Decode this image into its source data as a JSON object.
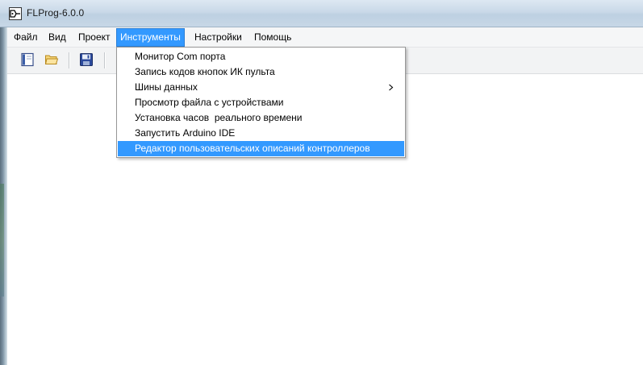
{
  "window": {
    "title": "FLProg-6.0.0"
  },
  "menubar": {
    "items": [
      {
        "label": "Файл"
      },
      {
        "label": "Вид"
      },
      {
        "label": "Проект"
      },
      {
        "label": "Инструменты"
      },
      {
        "label": "Настройки"
      },
      {
        "label": "Помощь"
      }
    ],
    "active_index": 3
  },
  "toolbar": {
    "buttons": [
      "new-project-icon",
      "open-folder-icon",
      "save-icon"
    ]
  },
  "dropdown": {
    "items": [
      {
        "label": "Монитор Com порта"
      },
      {
        "label": "Запись кодов кнопок ИК пульта"
      },
      {
        "label": "Шины данных",
        "submenu_icon": "chevron-right-icon"
      },
      {
        "label": "Просмотр файла с устройствами"
      },
      {
        "label": "Установка часов  реального времени"
      },
      {
        "label": "Запустить Arduino IDE"
      },
      {
        "label": "Редактор пользовательских описаний контроллеров"
      }
    ],
    "highlighted_index": 6
  },
  "colors": {
    "highlight": "#3399ff",
    "menubar_bg": "#f5f6f7",
    "titlebar_bg": "#c9d9e8"
  }
}
